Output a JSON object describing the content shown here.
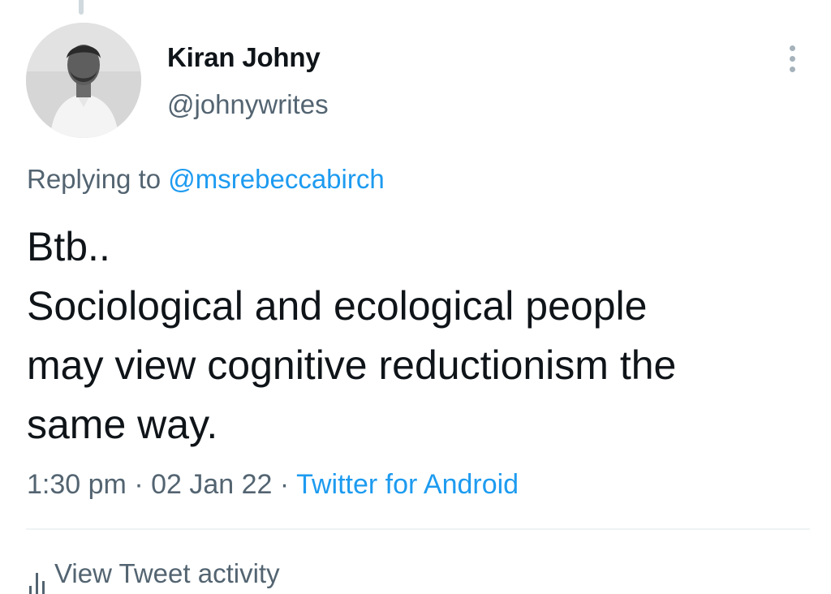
{
  "tweet": {
    "author": {
      "display_name": "Kiran Johny",
      "handle": "@johnywrites"
    },
    "reply": {
      "prefix": "Replying to",
      "mention": "@msrebeccabirch"
    },
    "text_lines": [
      "Btb..",
      "Sociological and ecological people",
      "may view cognitive reductionism the",
      "same way."
    ],
    "meta": {
      "time": "1:30 pm",
      "separator": "·",
      "date": "02 Jan 22",
      "source": "Twitter for Android"
    },
    "activity_label": "View Tweet activity"
  },
  "icons": {
    "more": "more-vertical-icon",
    "activity": "bar-chart-icon"
  },
  "colors": {
    "link": "#1d9bf0",
    "secondary_text": "#536471",
    "primary_text": "#0f1419"
  }
}
